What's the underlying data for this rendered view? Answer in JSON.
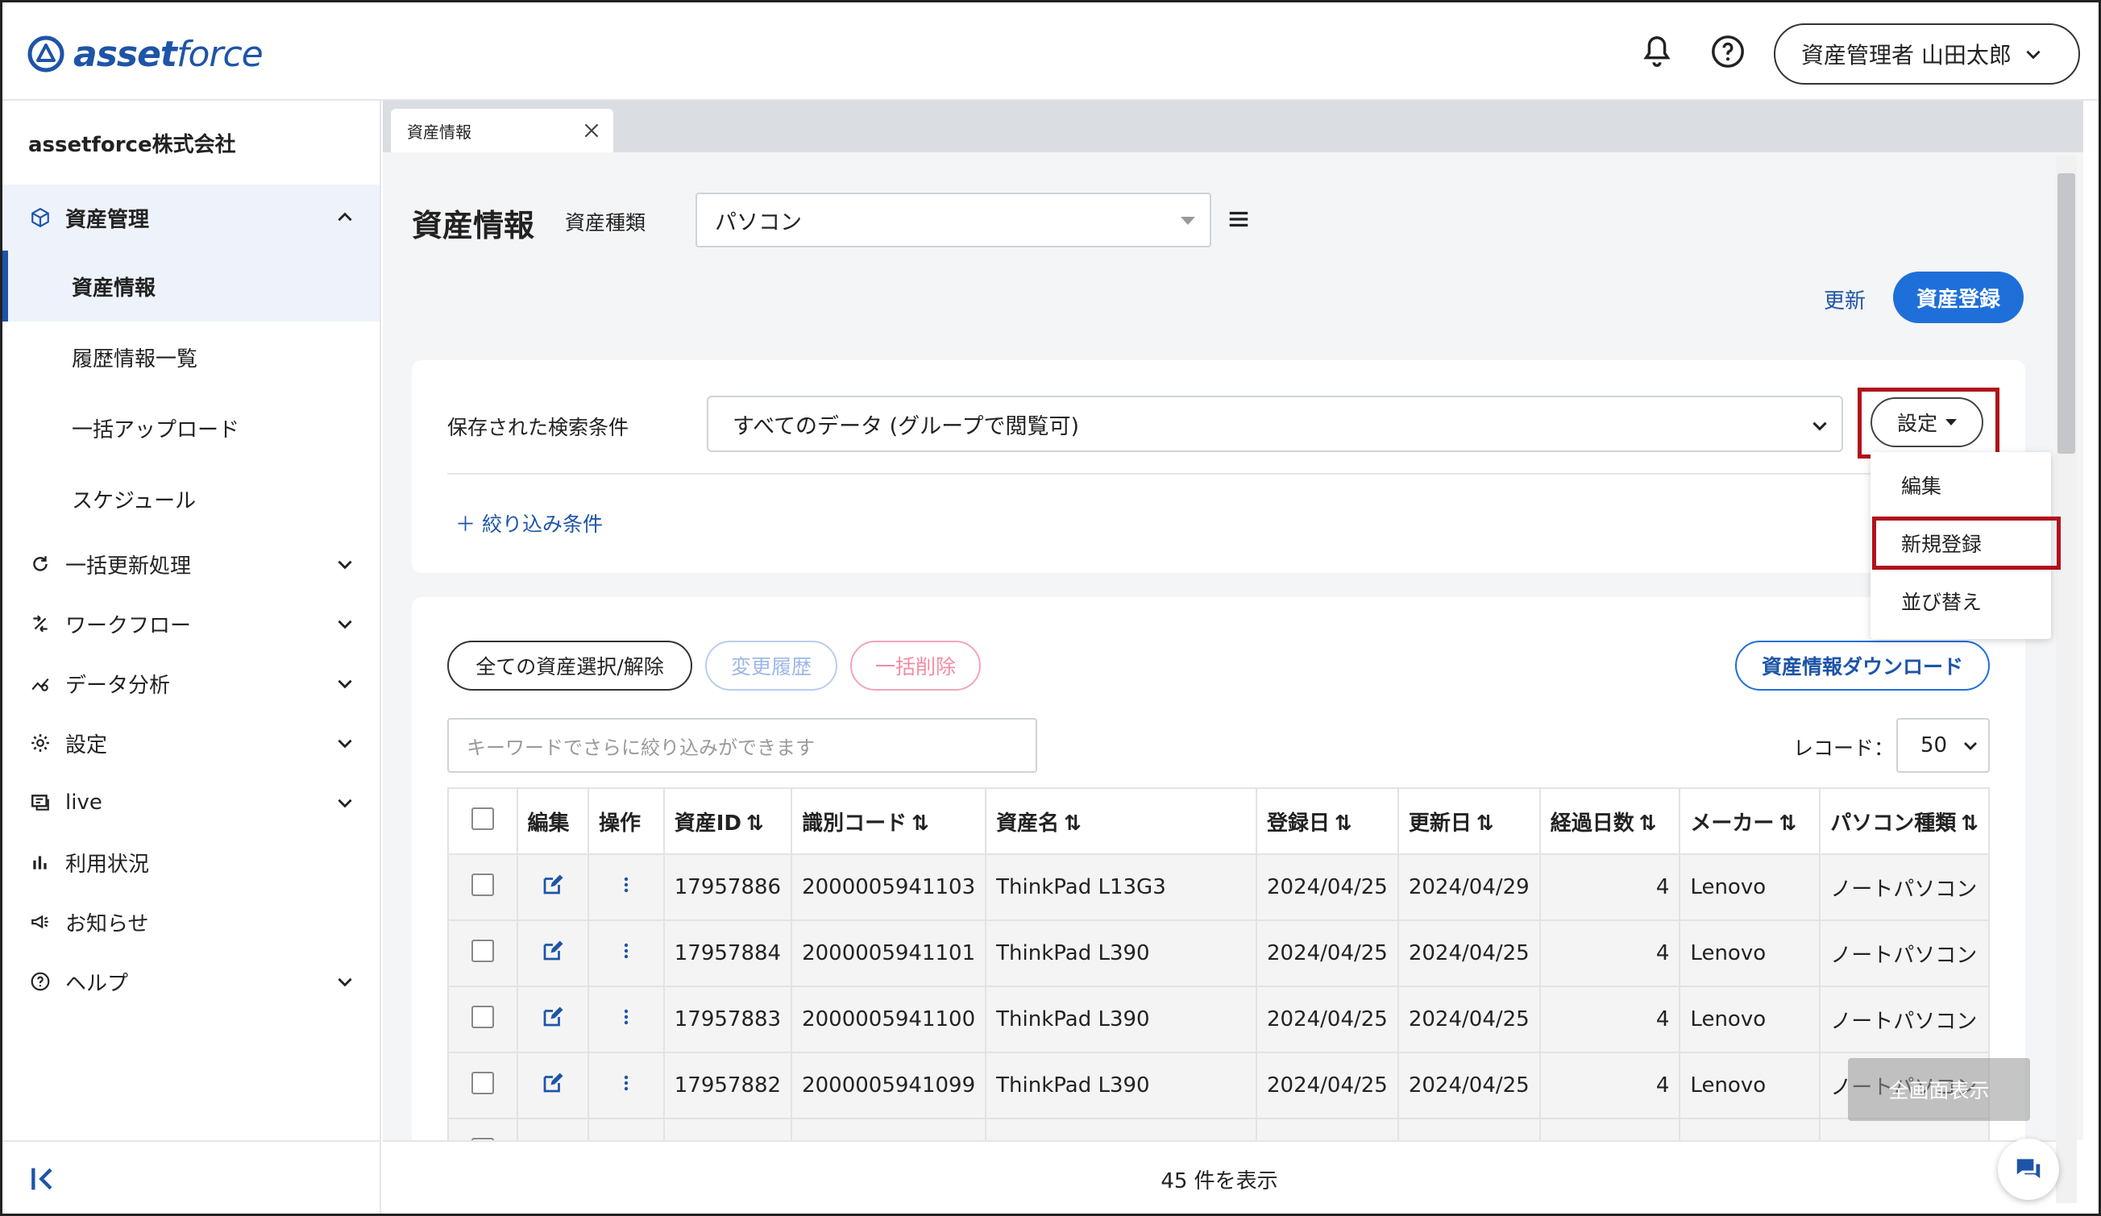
{
  "brand": {
    "name_bold": "asset",
    "name_light": "force"
  },
  "header": {
    "user_label": "資産管理者 山田太郎"
  },
  "sidebar": {
    "company": "assetforce株式会社",
    "items": [
      {
        "label": "資産管理",
        "icon": "cube-icon"
      },
      {
        "label": "資産情報"
      },
      {
        "label": "履歴情報一覧"
      },
      {
        "label": "一括アップロード"
      },
      {
        "label": "スケジュール"
      },
      {
        "label": "一括更新処理",
        "icon": "refresh-icon"
      },
      {
        "label": "ワークフロー",
        "icon": "workflow-icon"
      },
      {
        "label": "データ分析",
        "icon": "analytics-icon"
      },
      {
        "label": "設定",
        "icon": "gear-icon"
      },
      {
        "label": "live",
        "icon": "live-icon"
      },
      {
        "label": "利用状況",
        "icon": "bar-chart-icon"
      },
      {
        "label": "お知らせ",
        "icon": "megaphone-icon"
      },
      {
        "label": "ヘルプ",
        "icon": "help-icon"
      }
    ]
  },
  "tab": {
    "label": "資産情報"
  },
  "page": {
    "title": "資産情報",
    "type_label": "資産種類",
    "type_value": "パソコン",
    "refresh": "更新",
    "register": "資産登録"
  },
  "search": {
    "saved_label": "保存された検索条件",
    "saved_value": "すべてのデータ (グループで閲覧可)",
    "settings": "設定",
    "filter": "＋ 絞り込み条件",
    "menu": [
      "編集",
      "新規登録",
      "並び替え"
    ]
  },
  "actions": {
    "select_all": "全ての資産選択/解除",
    "history": "変更履歴",
    "bulk_delete": "一括削除",
    "download": "資産情報ダウンロード",
    "keyword_placeholder": "キーワードでさらに絞り込みができます",
    "record_label": "レコード：",
    "record_value": "50"
  },
  "table": {
    "headers": [
      "編集",
      "操作",
      "資産ID",
      "識別コード",
      "資産名",
      "登録日",
      "更新日",
      "経過日数",
      "メーカー",
      "パソコン種類"
    ],
    "rows": [
      {
        "id": "17957886",
        "code": "2000005941103",
        "name": "ThinkPad L13G3",
        "reg": "2024/04/25",
        "upd": "2024/04/29",
        "days": "4",
        "maker": "Lenovo",
        "kind": "ノートパソコン"
      },
      {
        "id": "17957884",
        "code": "2000005941101",
        "name": "ThinkPad L390",
        "reg": "2024/04/25",
        "upd": "2024/04/25",
        "days": "4",
        "maker": "Lenovo",
        "kind": "ノートパソコン"
      },
      {
        "id": "17957883",
        "code": "2000005941100",
        "name": "ThinkPad L390",
        "reg": "2024/04/25",
        "upd": "2024/04/25",
        "days": "4",
        "maker": "Lenovo",
        "kind": "ノートパソコン"
      },
      {
        "id": "17957882",
        "code": "2000005941099",
        "name": "ThinkPad L390",
        "reg": "2024/04/25",
        "upd": "2024/04/25",
        "days": "4",
        "maker": "Lenovo",
        "kind": "ノートパソコン"
      }
    ]
  },
  "overlay": {
    "fullscreen": "全画面表示"
  },
  "footer": {
    "count": "45 件を表示"
  },
  "colors": {
    "brand_blue": "#1e54a8",
    "primary_button": "#1e6fd9",
    "highlight_red": "#b0121b"
  }
}
